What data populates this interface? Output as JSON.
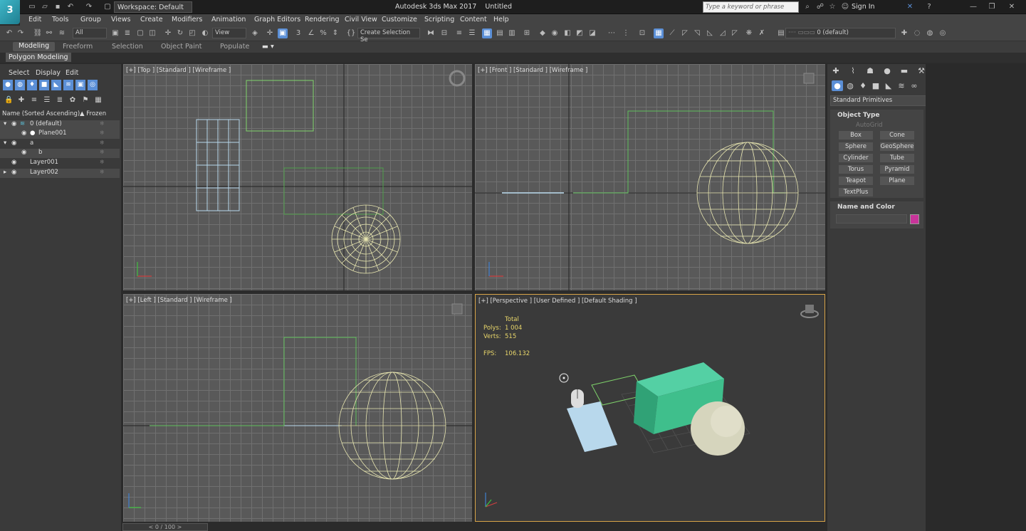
{
  "app": {
    "title": "Autodesk 3ds Max 2017",
    "doc": "Untitled",
    "workspace": "Workspace: Default",
    "search_placeholder": "Type a keyword or phrase",
    "sign_in": "Sign In",
    "logo_text": "3"
  },
  "menu": [
    "Edit",
    "Tools",
    "Group",
    "Views",
    "Create",
    "Modifiers",
    "Animation",
    "Graph Editors",
    "Rendering",
    "Civil View",
    "Customize",
    "Scripting",
    "Content",
    "Help"
  ],
  "toolbar": {
    "filter": "All",
    "view": "View",
    "selection_set": "Create Selection Se",
    "layer": "0 (default)"
  },
  "ribbon": {
    "tabs": [
      "Modeling",
      "Freeform",
      "Selection",
      "Object Paint",
      "Populate"
    ],
    "sub": "Polygon Modeling"
  },
  "scene_explorer": {
    "menus": [
      "Select",
      "Display",
      "Edit"
    ],
    "col_name": "Name (Sorted Ascending)",
    "col_frozen": "▲ Frozen",
    "rows": [
      "0 (default)",
      "Plane001",
      "a",
      "b",
      "Layer001",
      "Layer002"
    ]
  },
  "viewports": {
    "top": "[+] [Top ] [Standard ] [Wireframe ]",
    "front": "[+] [Front ] [Standard ] [Wireframe ]",
    "left": "[+] [Left ] [Standard ] [Wireframe ]",
    "persp": "[+] [Perspective ] [User Defined ] [Default Shading ]"
  },
  "stats": {
    "total": "Total",
    "polys_label": "Polys:",
    "polys": "1 004",
    "verts_label": "Verts:",
    "verts": "515",
    "fps_label": "FPS:",
    "fps": "106.132"
  },
  "command_panel": {
    "category": "Standard Primitives",
    "object_type": "Object Type",
    "autogrid": "AutoGrid",
    "buttons": [
      "Box",
      "Cone",
      "Sphere",
      "GeoSphere",
      "Cylinder",
      "Tube",
      "Torus",
      "Pyramid",
      "Teapot",
      "Plane",
      "TextPlus"
    ],
    "name_color": "Name and Color",
    "color": "#c8349a"
  },
  "timeline": "0 / 100"
}
